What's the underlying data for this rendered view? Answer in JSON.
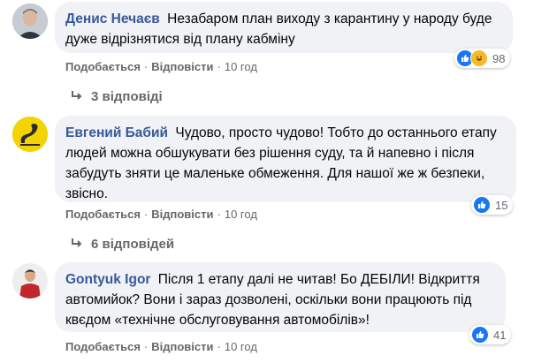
{
  "comments": [
    {
      "author": "Денис Нечаєв",
      "text": "Незабаром план виходу з карантину у народу буде дуже відрізнятися від плану кабміну",
      "like_label": "Подобається",
      "reply_label": "Відповісти",
      "time": "10 год",
      "reaction_count": "98",
      "reactions": [
        "like-icon",
        "haha-icon"
      ],
      "replies_label": "3 відповіді"
    },
    {
      "author": "Евгений Бабий",
      "text": "Чудово, просто чудово! Тобто до останнього етапу людей можна обшукувати без рішення суду, та й напевно і після забудуть зняти це маленьке обмеження. Для нашої же ж безпеки, звісно.",
      "like_label": "Подобається",
      "reply_label": "Відповісти",
      "time": "10 год",
      "reaction_count": "15",
      "reactions": [
        "like-icon"
      ],
      "replies_label": "6 відповідей"
    },
    {
      "author": "Gontyuk Igor",
      "text": "Після 1 етапу далі не читав! Бо ДЕБІЛИ! Відкриття автомийок? Вони і зараз дозволені, оскільки вони працюють під квєдом «технічне обслуговування автомобілів»!",
      "like_label": "Подобається",
      "reply_label": "Відповісти",
      "time": "10 год",
      "reaction_count": "41",
      "reactions": [
        "like-icon"
      ]
    }
  ],
  "colors": {
    "author": "#385898",
    "bubble": "#f0f2f5",
    "meta": "#65676b",
    "like": "#1877f2",
    "haha": "#f7b928"
  }
}
